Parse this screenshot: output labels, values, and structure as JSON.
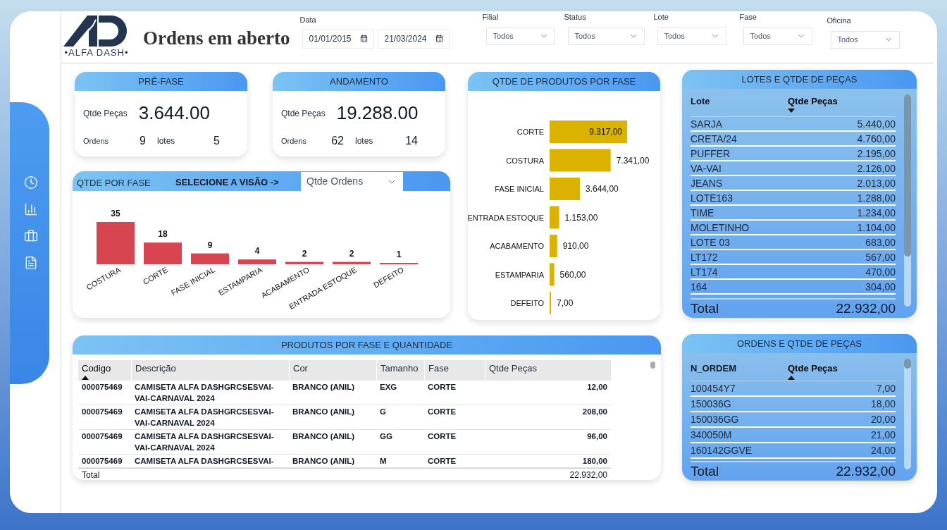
{
  "header": {
    "logo_text": "•ALFA DASH•",
    "title": "Ordens em aberto"
  },
  "date_filter": {
    "label": "Data",
    "start": "01/01/2015",
    "end": "21/03/2024"
  },
  "filters": [
    {
      "label": "Filial",
      "value": "Todos"
    },
    {
      "label": "Status",
      "value": "Todos"
    },
    {
      "label": "Lote",
      "value": "Todos"
    },
    {
      "label": "Fase",
      "value": "Todos"
    },
    {
      "label": "Oficina",
      "value": "Todos"
    }
  ],
  "kpi_cards": [
    {
      "title": "PRÉ-FASE",
      "metric_label": "Qtde Peças",
      "metric_value": "3.644.00",
      "stats": [
        {
          "label": "Ordens",
          "value": "9"
        },
        {
          "label": "lotes",
          "value": "5"
        }
      ]
    },
    {
      "title": "ANDAMENTO",
      "metric_label": "Qtde Peças",
      "metric_value": "19.288.00",
      "stats": [
        {
          "label": "Ordens",
          "value": "62"
        },
        {
          "label": "lotes",
          "value": "14"
        }
      ]
    }
  ],
  "qtde_por_fase": {
    "title": "QTDE POR FASE",
    "prompt": "SELECIONE A VISÃO ->",
    "view_select": "Qtde Ordens",
    "chart_data": {
      "type": "bar",
      "categories": [
        "COSTURA",
        "CORTE",
        "FASE INICIAL",
        "ESTAMPARIA",
        "ACABAMENTO",
        "ENTRADA ESTOQUE",
        "DEFEITO"
      ],
      "values": [
        35,
        18,
        9,
        4,
        2,
        2,
        1
      ],
      "data_labels": true
    }
  },
  "produtos_por_fase": {
    "title": "QTDE DE PRODUTOS POR FASE",
    "chart_data": {
      "type": "bar",
      "orientation": "horizontal",
      "categories": [
        "CORTE",
        "COSTURA",
        "FASE INICIAL",
        "ENTRADA ESTOQUE",
        "ACABAMENTO",
        "ESTAMPARIA",
        "DEFEITO"
      ],
      "values": [
        9317,
        7341,
        3644,
        1153,
        910,
        560,
        7
      ],
      "value_labels": [
        "9.317,00",
        "7.341,00",
        "3.644,00",
        "1.153,00",
        "910,00",
        "560,00",
        "7,00"
      ]
    }
  },
  "lotes_table": {
    "title": "LOTES E QTDE DE PEÇAS",
    "columns": [
      {
        "label": "Lote",
        "sorted": false
      },
      {
        "label": "Qtde Peças",
        "sorted": true,
        "descending": true
      }
    ],
    "rows": [
      [
        "SARJA",
        "5.440,00"
      ],
      [
        "CRETA/24",
        "4.760,00"
      ],
      [
        "PUFFER",
        "2.195,00"
      ],
      [
        "VA-VAI",
        "2.126,00"
      ],
      [
        "JEANS",
        "2.013,00"
      ],
      [
        "LOTE163",
        "1.288,00"
      ],
      [
        "TIME",
        "1.234,00"
      ],
      [
        "MOLETINHO",
        "1.104,00"
      ],
      [
        "LOTE 03",
        "683,00"
      ],
      [
        "LT172",
        "567,00"
      ],
      [
        "LT174",
        "470,00"
      ],
      [
        "164",
        "304,00"
      ]
    ],
    "total": {
      "label": "Total",
      "value": "22.932,00"
    }
  },
  "ordens_table": {
    "title": "ORDENS E QTDE DE PEÇAS",
    "columns": [
      {
        "label": "N_ORDEM",
        "sorted": false
      },
      {
        "label": "Qtde Peças",
        "sorted": true,
        "descending": false
      }
    ],
    "rows": [
      [
        "100454Y7",
        "7,00"
      ],
      [
        "150036G",
        "18,00"
      ],
      [
        "150036GG",
        "20,00"
      ],
      [
        "340050M",
        "21,00"
      ],
      [
        "160142GGVE",
        "24,00"
      ]
    ],
    "total": {
      "label": "Total",
      "value": "22.932,00"
    }
  },
  "produtos_table": {
    "title": "PRODUTOS POR FASE E QUANTIDADE",
    "columns": [
      {
        "label": "Codigo",
        "sorted": true,
        "descending": false
      },
      {
        "label": "Descrição",
        "sorted": false
      },
      {
        "label": "Cor",
        "sorted": false
      },
      {
        "label": "Tamanho",
        "sorted": false
      },
      {
        "label": "Fase",
        "sorted": false
      },
      {
        "label": "Qtde Peças",
        "sorted": false
      }
    ],
    "rows": [
      [
        "000075469",
        "CAMISETA ALFA DASHGRCSESVAI-VAI-CARNAVAL 2024",
        "BRANCO (ANIL)",
        "EXG",
        "CORTE",
        "12,00"
      ],
      [
        "000075469",
        "CAMISETA ALFA DASHGRCSESVAI-VAI-CARNAVAL 2024",
        "BRANCO (ANIL)",
        "G",
        "CORTE",
        "208,00"
      ],
      [
        "000075469",
        "CAMISETA ALFA DASHGRCSESVAI-VAI-CARNAVAL 2024",
        "BRANCO (ANIL)",
        "GG",
        "CORTE",
        "96,00"
      ],
      [
        "000075469",
        "CAMISETA ALFA DASHGRCSESVAI-",
        "BRANCO (ANIL)",
        "M",
        "CORTE",
        "180,00"
      ]
    ],
    "total": {
      "label": "Total",
      "value": "22.932,00"
    }
  }
}
